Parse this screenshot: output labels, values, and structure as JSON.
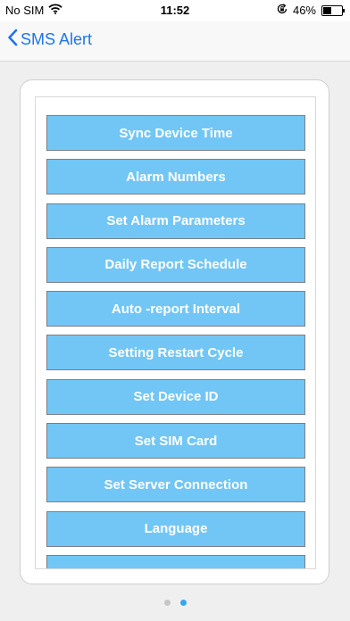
{
  "status_bar": {
    "carrier": "No SIM",
    "time": "11:52",
    "battery_text": "46%",
    "battery_level_percent": 46,
    "icons": [
      "wifi-icon",
      "orientation-lock-icon",
      "battery-icon"
    ]
  },
  "nav": {
    "back_label": "SMS Alert",
    "accent_color": "#1f74e8"
  },
  "menu": {
    "button_color": "#72c6f5",
    "items": [
      {
        "label": "Sync Device Time"
      },
      {
        "label": "Alarm Numbers"
      },
      {
        "label": "Set Alarm Parameters"
      },
      {
        "label": "Daily Report Schedule"
      },
      {
        "label": "Auto -report Interval"
      },
      {
        "label": "Setting Restart Cycle"
      },
      {
        "label": "Set Device ID"
      },
      {
        "label": "Set SIM Card"
      },
      {
        "label": "Set Server Connection"
      },
      {
        "label": "Language"
      },
      {
        "label": ""
      }
    ]
  },
  "pager": {
    "page_count": 2,
    "current_page": 2
  }
}
